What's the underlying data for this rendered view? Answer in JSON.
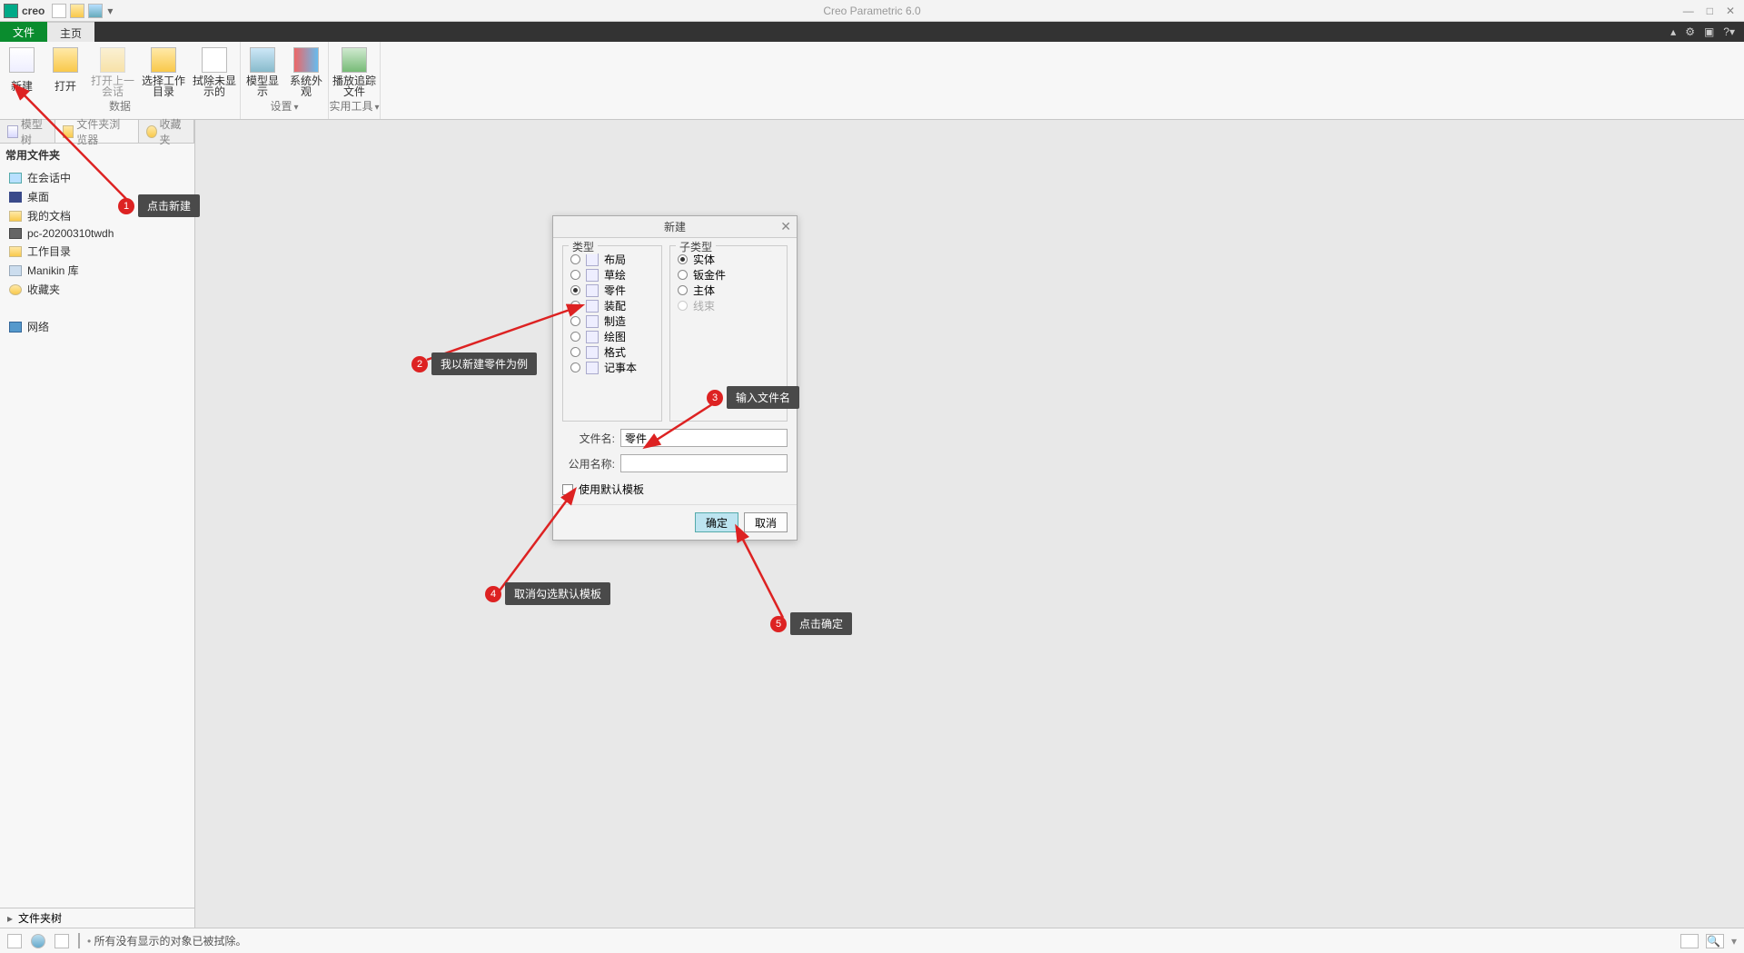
{
  "titlebar": {
    "brand": "creo",
    "app_title": "Creo Parametric 6.0"
  },
  "menutabs": {
    "file": "文件",
    "home": "主页"
  },
  "ribbon": {
    "data_group": "数据",
    "settings_group": "设置",
    "tools_group": "实用工具",
    "new_btn": "新建",
    "open_btn": "打开",
    "open_last": "打开上一会话",
    "select_wd": "选择工作目录",
    "erase_hidden": "拭除未显示的",
    "model_disp": "模型显示",
    "sys_appear": "系统外观",
    "play_trace": "播放追踪文件"
  },
  "side": {
    "tab_model_tree": "模型树",
    "tab_folder_browser": "文件夹浏览器",
    "tab_favorites": "收藏夹",
    "heading": "常用文件夹",
    "in_session": "在会话中",
    "desktop": "桌面",
    "my_docs": "我的文档",
    "pc_name": "pc-20200310twdh",
    "work_dir": "工作目录",
    "manikin": "Manikin 库",
    "fav": "收藏夹",
    "network": "网络",
    "folder_tree": "文件夹树"
  },
  "dialog": {
    "title": "新建",
    "type_legend": "类型",
    "subtype_legend": "子类型",
    "types": {
      "layout": "布局",
      "sketch": "草绘",
      "part": "零件",
      "assembly": "装配",
      "mfg": "制造",
      "drawing": "绘图",
      "format": "格式",
      "notebook": "记事本"
    },
    "subtypes": {
      "solid": "实体",
      "sheetmetal": "钣金件",
      "bulk": "主体",
      "harness": "线束"
    },
    "filename_label": "文件名:",
    "filename_value": "零件",
    "common_label": "公用名称:",
    "common_value": "",
    "use_default": "使用默认模板",
    "ok": "确定",
    "cancel": "取消"
  },
  "annotations": {
    "a1": "点击新建",
    "a2": "我以新建零件为例",
    "a3": "输入文件名",
    "a4": "取消勾选默认模板",
    "a5": "点击确定"
  },
  "status": {
    "msg": "所有没有显示的对象已被拭除。"
  }
}
